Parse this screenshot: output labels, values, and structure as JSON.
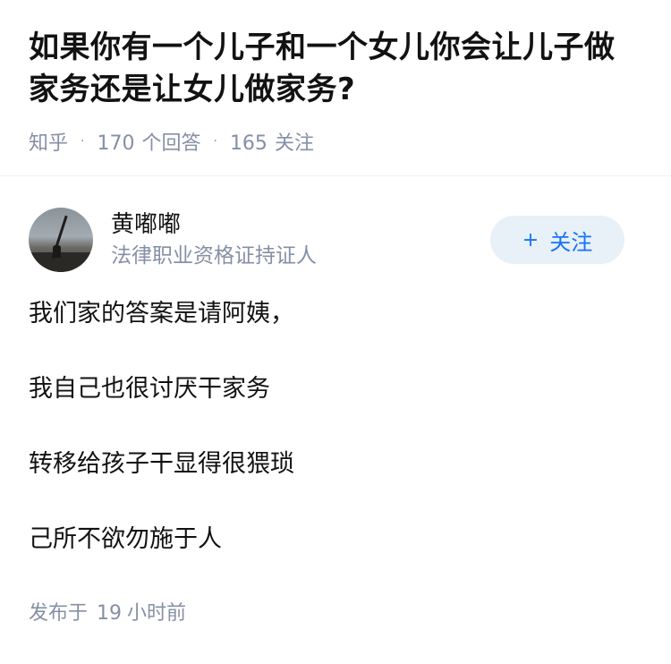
{
  "question": {
    "title": "如果你有一个儿子和一个女儿你会让儿子做家务还是让女儿做家务?",
    "source": "知乎",
    "separator": "·",
    "answer_count": "170",
    "answer_label": "个回答",
    "follower_count": "165",
    "follower_label": "关注"
  },
  "answer": {
    "author_name": "黄嘟嘟",
    "author_bio": "法律职业资格证持证人",
    "follow_button": {
      "icon": "plus-icon",
      "symbol": "+",
      "label": "关注"
    },
    "paragraphs": [
      "我们家的答案是请阿姨，",
      "我自己也很讨厌干家务",
      "转移给孩子干显得很猥琐",
      "己所不欲勿施于人"
    ],
    "posted_label": "发布于",
    "posted_value": "19",
    "posted_unit": "小时前"
  },
  "colors": {
    "primary_text": "#121212",
    "secondary_text": "#8590a6",
    "follow_bg": "#e8f0f8",
    "follow_text": "#1772f6"
  }
}
